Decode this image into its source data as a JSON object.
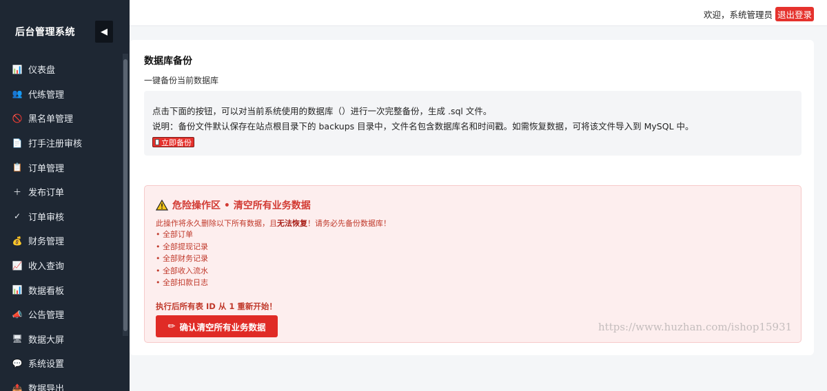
{
  "sidebar": {
    "brand": "后台管理系统",
    "collapse_icon": "◀",
    "items": [
      {
        "label": "仪表盘",
        "icon": "bar-chart-icon",
        "glyph": "📊"
      },
      {
        "label": "代练管理",
        "icon": "users-icon",
        "glyph": "👥"
      },
      {
        "label": "黑名单管理",
        "icon": "ban-icon",
        "glyph": "🚫"
      },
      {
        "label": "打手注册审核",
        "icon": "document-icon",
        "glyph": "📄"
      },
      {
        "label": "订单管理",
        "icon": "clipboard-icon",
        "glyph": "📋"
      },
      {
        "label": "发布订单",
        "icon": "plus-icon",
        "glyph": "＋"
      },
      {
        "label": "订单审核",
        "icon": "check-icon",
        "glyph": "✓"
      },
      {
        "label": "财务管理",
        "icon": "money-bag-icon",
        "glyph": "💰"
      },
      {
        "label": "收入查询",
        "icon": "trend-chart-icon",
        "glyph": "📈"
      },
      {
        "label": "数据看板",
        "icon": "bar-chart-icon",
        "glyph": "📊"
      },
      {
        "label": "公告管理",
        "icon": "megaphone-icon",
        "glyph": "📣"
      },
      {
        "label": "数据大屏",
        "icon": "monitor-icon",
        "glyph": "🖥"
      },
      {
        "label": "系统设置",
        "icon": "speech-bubble-icon",
        "glyph": "💬"
      },
      {
        "label": "数据导出",
        "icon": "export-icon",
        "glyph": "📤"
      }
    ]
  },
  "topbar": {
    "welcome": "欢迎，系统管理员",
    "logout": "退出登录"
  },
  "backup": {
    "title": "数据库备份",
    "subtitle": "一键备份当前数据库",
    "line1": "点击下面的按钮，可以对当前系统使用的数据库（）进行一次完整备份，生成 .sql 文件。",
    "line2": "说明：备份文件默认保存在站点根目录下的 backups 目录中，文件名包含数据库名和时间戳。如需恢复数据，可将该文件导入到 MySQL 中。",
    "button": "立即备份"
  },
  "danger": {
    "title": "危险操作区 • 清空所有业务数据",
    "desc_prefix": "此操作将永久删除以下所有数据，且",
    "desc_bold": "无法恢复",
    "desc_suffix": "！请务必先备份数据库！",
    "items": [
      "• 全部订单",
      "• 全部提现记录",
      "• 全部财务记录",
      "• 全部收入流水",
      "• 全部扣款日志"
    ],
    "note": "执行后所有表 ID 从 1 重新开始！",
    "button": "确认清空所有业务数据",
    "accent": "#e02b26"
  },
  "watermark": "https://www.huzhan.com/ishop15931"
}
